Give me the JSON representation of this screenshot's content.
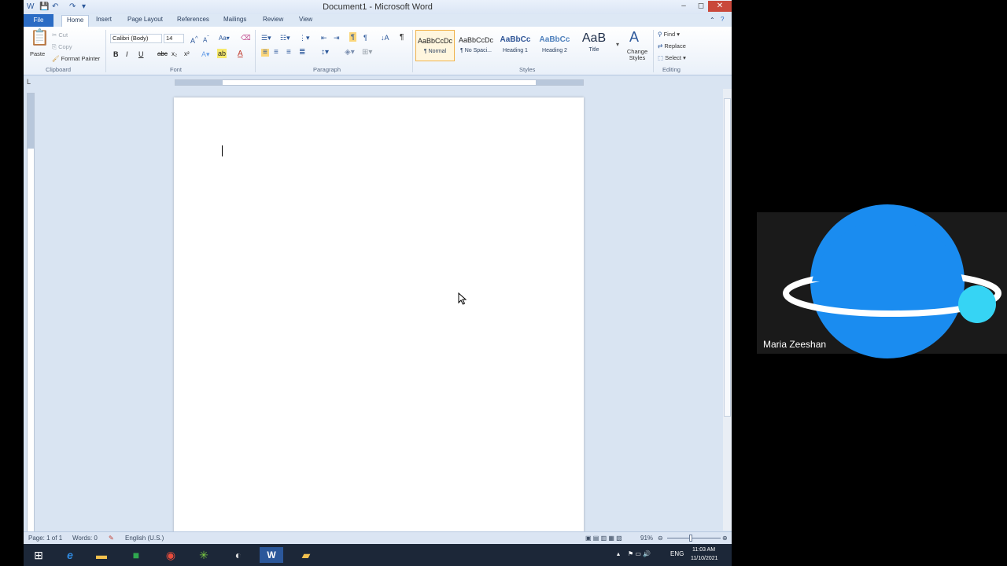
{
  "window": {
    "title": "Document1 - Microsoft Word",
    "min_label": "–",
    "max_label": "◻",
    "close_label": "✕"
  },
  "tabs": [
    "File",
    "Home",
    "Insert",
    "Page Layout",
    "References",
    "Mailings",
    "Review",
    "View"
  ],
  "ribbon": {
    "clipboard": {
      "paste": "Paste",
      "cut": "Cut",
      "copy": "Copy",
      "format_painter": "Format Painter",
      "group": "Clipboard"
    },
    "font": {
      "family": "Calibri (Body)",
      "size": "14",
      "group": "Font"
    },
    "paragraph": {
      "group": "Paragraph"
    },
    "styles": {
      "items": [
        {
          "preview": "AaBbCcDc",
          "name": "¶ Normal"
        },
        {
          "preview": "AaBbCcDc",
          "name": "¶ No Spaci..."
        },
        {
          "preview": "AaBbCc",
          "name": "Heading 1"
        },
        {
          "preview": "AaBbCc",
          "name": "Heading 2"
        },
        {
          "preview": "AaB",
          "name": "Title"
        }
      ],
      "change_styles": "Change Styles",
      "group": "Styles"
    },
    "editing": {
      "find": "Find",
      "replace": "Replace",
      "select": "Select",
      "group": "Editing"
    }
  },
  "status": {
    "page": "Page: 1 of 1",
    "words": "Words: 0",
    "language": "English (U.S.)",
    "zoom": "91%"
  },
  "tray": {
    "lang": "ENG",
    "time": "11:03 AM",
    "date": "11/10/2021"
  },
  "participant": {
    "name": "Maria Zeeshan"
  },
  "colors": {
    "planet": "#1a8cf0",
    "moon": "#36d4f4",
    "file_tab": "#2b6cc4"
  }
}
